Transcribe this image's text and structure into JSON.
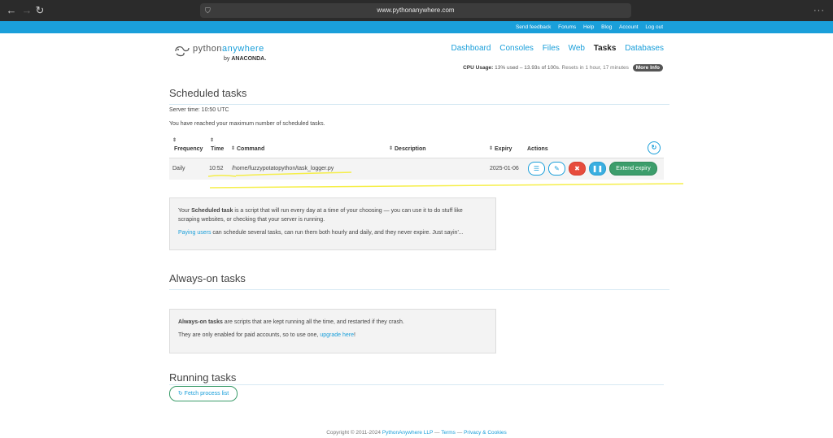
{
  "browser": {
    "url": "www.pythonanywhere.com",
    "back_icon": "←",
    "forward_icon": "→",
    "reload_icon": "↻",
    "menu_icon": "···"
  },
  "toplinks": [
    "Send feedback",
    "Forums",
    "Help",
    "Blog",
    "Account",
    "Log out"
  ],
  "logo": {
    "python": "python",
    "anywhere": "anywhere",
    "by": "by",
    "anaconda": "ANACONDA."
  },
  "nav": [
    "Dashboard",
    "Consoles",
    "Files",
    "Web",
    "Tasks",
    "Databases"
  ],
  "cpu": {
    "label": "CPU Usage:",
    "text": "13% used – 13.93s of 100s.",
    "reset": "Resets in 1 hour, 17 minutes",
    "more": "More Info"
  },
  "scheduled": {
    "title": "Scheduled tasks",
    "server_time": "Server time: 10:50 UTC",
    "max_msg": "You have reached your maximum number of scheduled tasks.",
    "columns": {
      "frequency": "Frequency",
      "time": "Time",
      "command": "Command",
      "description": "Description",
      "expiry": "Expiry",
      "actions": "Actions"
    },
    "row": {
      "frequency": "Daily",
      "time": "10:52",
      "command": "/home/fuzzypotatopython/task_logger.py",
      "description": "",
      "expiry": "2025-01-06",
      "extend": "Extend expiry"
    },
    "info": {
      "p1a": "Your ",
      "p1b": "Scheduled task",
      "p1c": " is a script that will run every day at a time of your choosing — you can use it to do stuff like",
      "p1d": "scraping websites, or checking that your server is running.",
      "p2a": "Paying users",
      "p2b": " can schedule several tasks, can run them both hourly and daily, and they never expire. Just sayin'..."
    }
  },
  "always_on": {
    "title": "Always-on tasks",
    "p1a": "Always-on tasks",
    "p1b": " are scripts that are kept running all the time, and restarted if they crash.",
    "p2a": "They are only enabled for paid accounts, so to use one, ",
    "p2b": "upgrade here",
    "p2c": "!"
  },
  "running": {
    "title": "Running tasks",
    "fetch": "Fetch process list"
  },
  "footer": {
    "copy": "Copyright © 2011-2024 ",
    "llp": "PythonAnywhere LLP",
    "sep1": " — ",
    "terms": "Terms",
    "sep2": " — ",
    "privacy": "Privacy & Cookies"
  },
  "colors": {
    "accent": "#1a9fda",
    "green": "#3c9d6b",
    "red": "#e74c3c",
    "highlight": "#f5ec2a"
  }
}
